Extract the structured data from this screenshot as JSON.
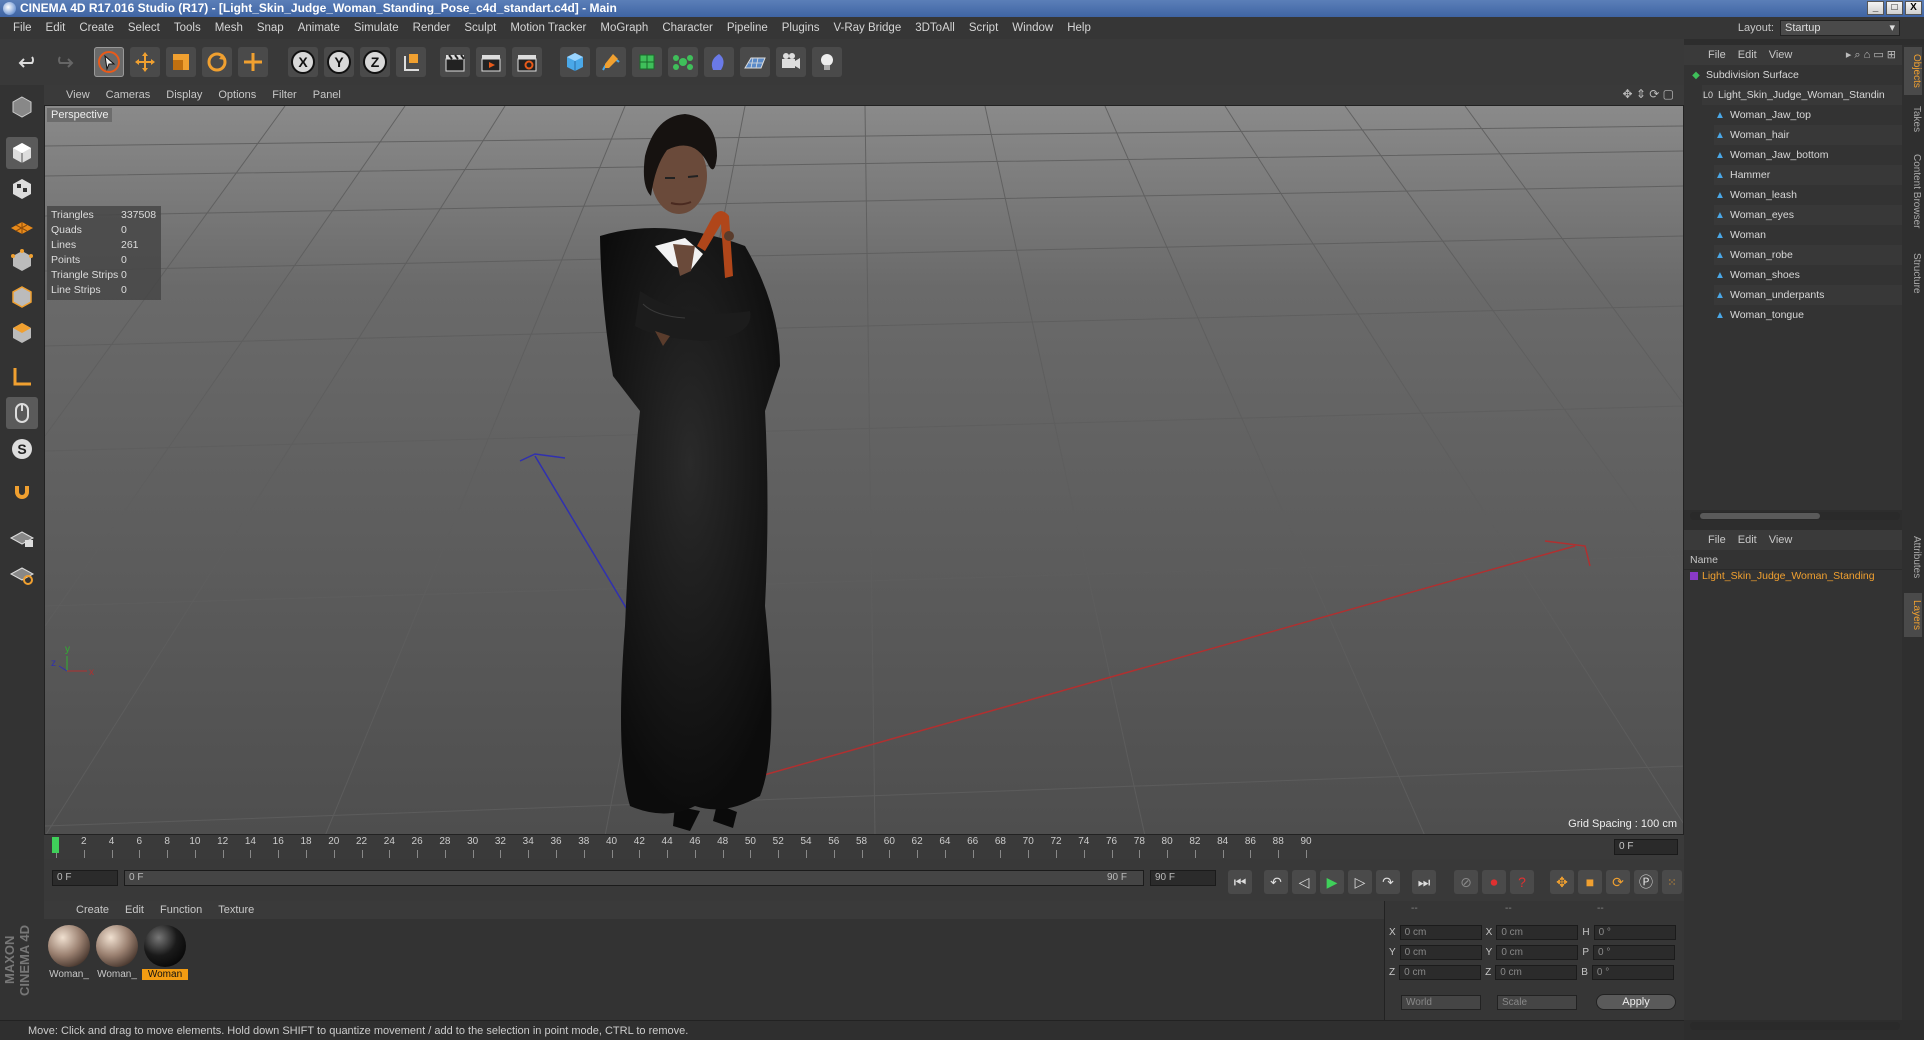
{
  "window": {
    "title": "CINEMA 4D R17.016 Studio (R17) - [Light_Skin_Judge_Woman_Standing_Pose_c4d_standart.c4d] - Main",
    "controls": [
      "_",
      "□",
      "X"
    ]
  },
  "menubar": {
    "items": [
      "File",
      "Edit",
      "Create",
      "Select",
      "Tools",
      "Mesh",
      "Snap",
      "Animate",
      "Simulate",
      "Render",
      "Sculpt",
      "Motion Tracker",
      "MoGraph",
      "Character",
      "Pipeline",
      "Plugins",
      "V-Ray Bridge",
      "3DToAll",
      "Script",
      "Window",
      "Help"
    ],
    "layout_label": "Layout:",
    "layout_value": "Startup"
  },
  "toolbar": {
    "axis_x": "X",
    "axis_y": "Y",
    "axis_z": "Z"
  },
  "viewport": {
    "menu": [
      "View",
      "Cameras",
      "Display",
      "Options",
      "Filter",
      "Panel"
    ],
    "label": "Perspective",
    "stats": [
      {
        "k": "Triangles",
        "v": "337508"
      },
      {
        "k": "Quads",
        "v": "0"
      },
      {
        "k": "Lines",
        "v": "261"
      },
      {
        "k": "Points",
        "v": "0"
      },
      {
        "k": "Triangle Strips",
        "v": "0"
      },
      {
        "k": "Line Strips",
        "v": "0"
      }
    ],
    "grid_spacing": "Grid Spacing : 100 cm"
  },
  "timeline": {
    "ticks": [
      "0",
      "2",
      "4",
      "6",
      "8",
      "10",
      "12",
      "14",
      "16",
      "18",
      "20",
      "22",
      "24",
      "26",
      "28",
      "30",
      "32",
      "34",
      "36",
      "38",
      "40",
      "42",
      "44",
      "46",
      "48",
      "50",
      "52",
      "54",
      "56",
      "58",
      "60",
      "62",
      "64",
      "66",
      "68",
      "70",
      "72",
      "74",
      "76",
      "78",
      "80",
      "82",
      "84",
      "86",
      "88",
      "90"
    ],
    "current_frame": "0 F",
    "start_field": "0 F",
    "range_start": "0 F",
    "range_end": "90 F",
    "end_field": "90 F"
  },
  "materials": {
    "menu": [
      "Create",
      "Edit",
      "Function",
      "Texture"
    ],
    "items": [
      {
        "label": "Woman_",
        "color": "#9a8070"
      },
      {
        "label": "Woman_",
        "color": "#9a8070"
      },
      {
        "label": "Woman",
        "color": "#1a1a1a"
      }
    ]
  },
  "coords": {
    "headers": [
      "--",
      "--",
      "--"
    ],
    "rows": [
      {
        "a": "X",
        "av": "0 cm",
        "b": "X",
        "bv": "0 cm",
        "c": "H",
        "cv": "0 °"
      },
      {
        "a": "Y",
        "av": "0 cm",
        "b": "Y",
        "bv": "0 cm",
        "c": "P",
        "cv": "0 °"
      },
      {
        "a": "Z",
        "av": "0 cm",
        "b": "Z",
        "bv": "0 cm",
        "c": "B",
        "cv": "0 °"
      }
    ],
    "world": "World",
    "scale": "Scale",
    "apply": "Apply"
  },
  "status": "Move: Click and drag to move elements. Hold down SHIFT to quantize movement / add to the selection in point mode, CTRL to remove.",
  "branding": "MAXON CINEMA 4D",
  "objects": {
    "menu": [
      "File",
      "Edit",
      "View"
    ],
    "items": [
      {
        "label": "Subdivision Surface",
        "indent": 0
      },
      {
        "label": "Light_Skin_Judge_Woman_Standin",
        "indent": 1
      },
      {
        "label": "Woman_Jaw_top",
        "indent": 2
      },
      {
        "label": "Woman_hair",
        "indent": 2
      },
      {
        "label": "Woman_Jaw_bottom",
        "indent": 2
      },
      {
        "label": "Hammer",
        "indent": 2
      },
      {
        "label": "Woman_leash",
        "indent": 2
      },
      {
        "label": "Woman_eyes",
        "indent": 2
      },
      {
        "label": "Woman",
        "indent": 2
      },
      {
        "label": "Woman_robe",
        "indent": 2
      },
      {
        "label": "Woman_shoes",
        "indent": 2
      },
      {
        "label": "Woman_underpants",
        "indent": 2
      },
      {
        "label": "Woman_tongue",
        "indent": 2
      }
    ]
  },
  "layers": {
    "menu": [
      "File",
      "Edit",
      "View"
    ],
    "header": "Name",
    "item": "Light_Skin_Judge_Woman_Standing"
  },
  "right_tabs": [
    "Objects",
    "Takes",
    "Content Browser",
    "Structure",
    "Attributes",
    "Layers"
  ]
}
